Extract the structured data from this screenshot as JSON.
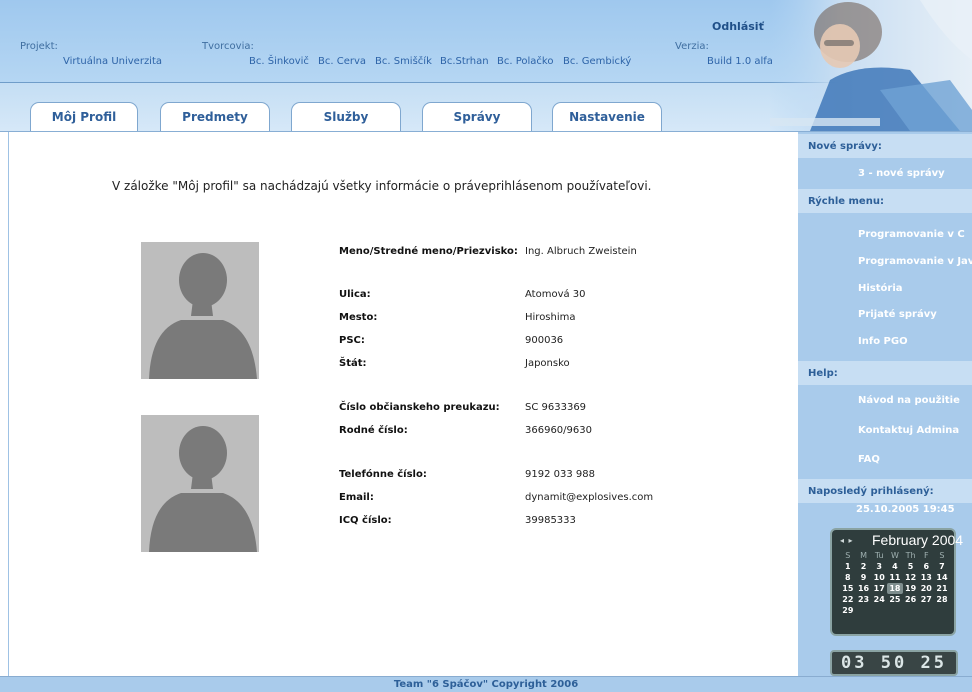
{
  "header": {
    "logout_label": "Odhlásiť",
    "project_label": "Projekt:",
    "project_value": "Virtuálna Univerzita",
    "authors_label": "Tvorcovia:",
    "authors": [
      "Bc. Šinkovič",
      "Bc. Cerva",
      "Bc. Smiščík",
      "Bc.Strhan",
      "Bc. Polačko",
      "Bc. Gembický"
    ],
    "version_label": "Verzia:",
    "version_value": "Build 1.0 alfa"
  },
  "tabs": [
    "Môj Profil",
    "Predmety",
    "Služby",
    "Správy",
    "Nastavenie"
  ],
  "main": {
    "intro": "V záložke \"Môj profil\" sa nachádzajú všetky informácie o práveprihlásenom používateľovi.",
    "fields": [
      {
        "label": "Meno/Stredné meno/Priezvisko:",
        "value": "Ing. Albruch Zweistein"
      },
      {
        "label": "Ulica:",
        "value": "Atomová 30"
      },
      {
        "label": "Mesto:",
        "value": "Hiroshima"
      },
      {
        "label": "PSC:",
        "value": "900036"
      },
      {
        "label": "Štát:",
        "value": "Japonsko"
      },
      {
        "label": "Číslo občianskeho preukazu:",
        "value": "SC 9633369"
      },
      {
        "label": "Rodné číslo:",
        "value": "366960/9630"
      },
      {
        "label": "Telefónne číslo:",
        "value": "9192 033 988"
      },
      {
        "label": "Email:",
        "value": "dynamit@explosives.com"
      },
      {
        "label": "ICQ číslo:",
        "value": "39985333"
      }
    ]
  },
  "sidebar": {
    "new_messages_head": "Nové správy:",
    "new_messages_link": "3 - nové správy",
    "quick_menu_head": "Rýchle menu:",
    "quick_menu": [
      "Programovanie v C",
      "Programovanie v Jav",
      "História",
      "Prijaté správy",
      "Info PGO"
    ],
    "help_head": "Help:",
    "help_links": [
      "Návod na použitie",
      "Kontaktuj Admina",
      "FAQ"
    ],
    "last_login_head": "Naposledý prihlásený:",
    "last_login_value": "25.10.2005 19:45"
  },
  "calendar": {
    "nav": "◂ ▸",
    "title": "February 2004",
    "weekdays": [
      "S",
      "M",
      "Tu",
      "W",
      "Th",
      "F",
      "S"
    ],
    "weeks": [
      [
        "1",
        "2",
        "3",
        "4",
        "5",
        "6",
        "7"
      ],
      [
        "8",
        "9",
        "10",
        "11",
        "12",
        "13",
        "14"
      ],
      [
        "15",
        "16",
        "17",
        "18",
        "19",
        "20",
        "21"
      ],
      [
        "22",
        "23",
        "24",
        "25",
        "26",
        "27",
        "28"
      ],
      [
        "29",
        "",
        "",
        "",
        "",
        "",
        ""
      ]
    ],
    "today": "18"
  },
  "clock": "03 50 25",
  "footer": "Team \"6 Spáčov\"   Copyright 2006",
  "colors": {
    "header_bg": "#a9cbeb",
    "link_blue": "#2e64a8",
    "sidebar_bg": "#a9cbeb"
  }
}
